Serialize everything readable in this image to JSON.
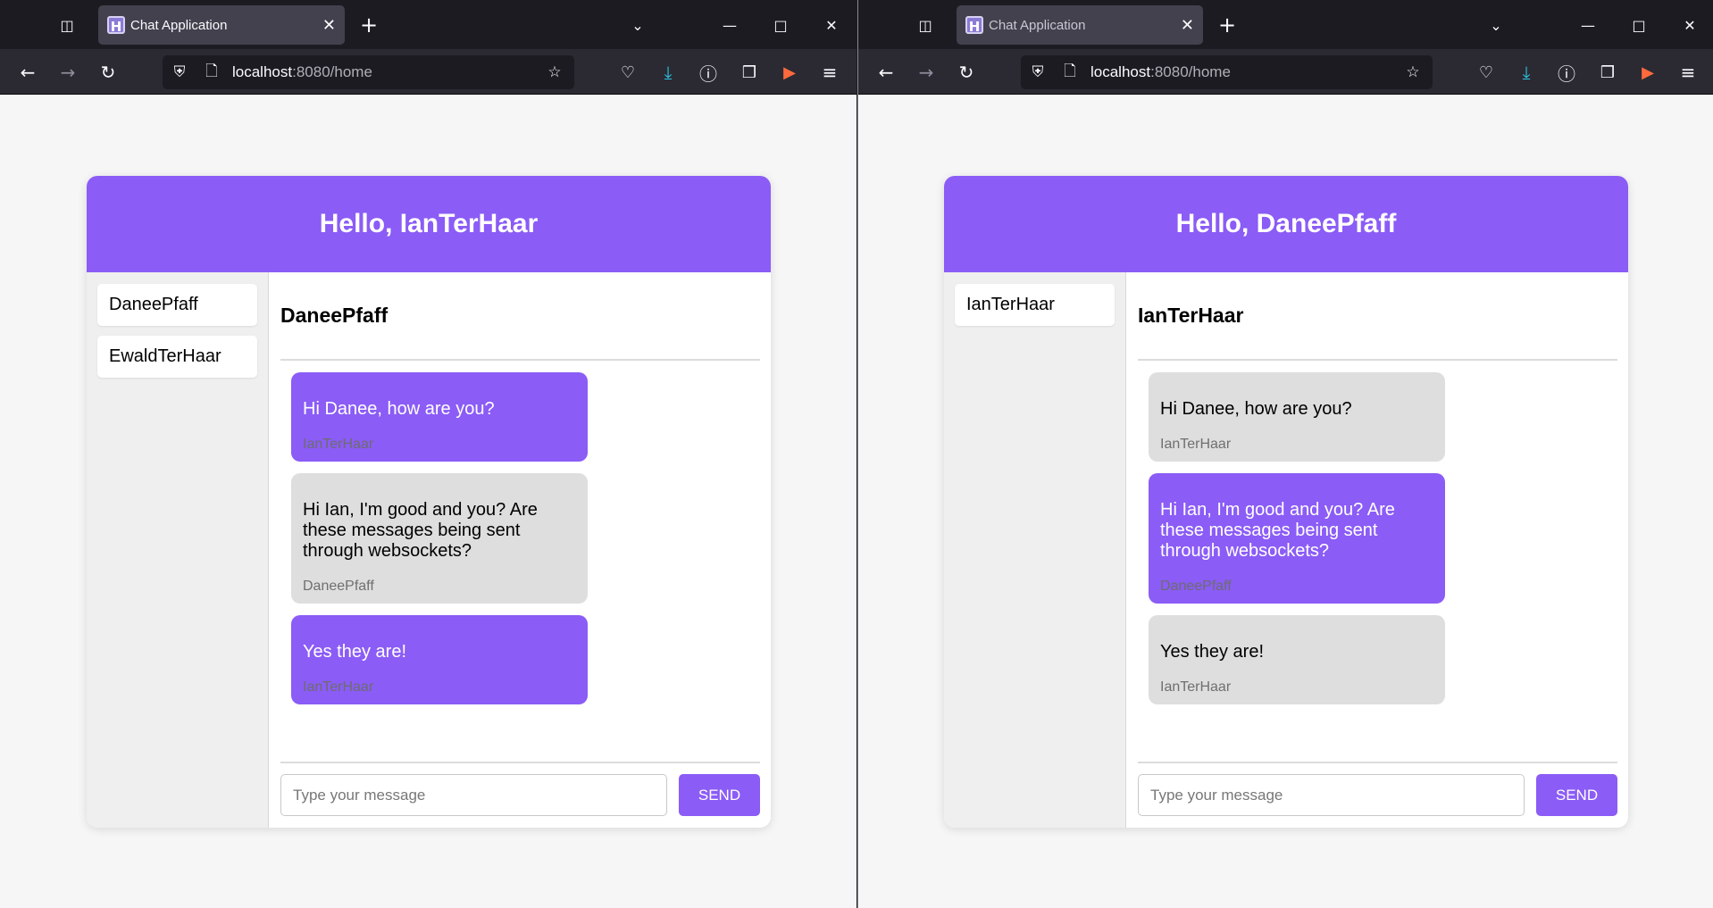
{
  "colors": {
    "accent": "#8b5cf6",
    "received_bubble": "#dedede",
    "browser_chrome": "#1c1b22"
  },
  "browser": {
    "tab_title": "Chat Application",
    "url_host": "localhost",
    "url_path": ":8080/home",
    "icons": [
      "tab-overview-icon",
      "favicon-h-icon",
      "tab-close-icon",
      "new-tab-icon",
      "tab-list-chevron-icon",
      "minimize-icon",
      "maximize-icon",
      "window-close-icon",
      "back-icon",
      "forward-icon",
      "reload-icon",
      "shield-icon",
      "page-icon",
      "bookmark-star-icon",
      "pocket-icon",
      "download-icon",
      "info-icon",
      "extensions-icon",
      "extension-megaphone-icon",
      "menu-icon"
    ]
  },
  "windows": [
    {
      "greeting": "Hello, IanTerHaar",
      "contacts": [
        "DaneePfaff",
        "EwaldTerHaar"
      ],
      "chat_title": "DaneePfaff",
      "messages": [
        {
          "text": "Hi Danee, how are you?",
          "author": "IanTerHaar",
          "type": "sent"
        },
        {
          "text": "Hi Ian, I'm good and you? Are these messages being sent through websockets?",
          "author": "DaneePfaff",
          "type": "recv"
        },
        {
          "text": "Yes they are!",
          "author": "IanTerHaar",
          "type": "sent"
        }
      ],
      "input_placeholder": "Type your message",
      "send_label": "SEND"
    },
    {
      "greeting": "Hello, DaneePfaff",
      "contacts": [
        "IanTerHaar"
      ],
      "chat_title": "IanTerHaar",
      "messages": [
        {
          "text": "Hi Danee, how are you?",
          "author": "IanTerHaar",
          "type": "recv"
        },
        {
          "text": "Hi Ian, I'm good and you? Are these messages being sent through websockets?",
          "author": "DaneePfaff",
          "type": "sent"
        },
        {
          "text": "Yes they are!",
          "author": "IanTerHaar",
          "type": "recv"
        }
      ],
      "input_placeholder": "Type your message",
      "send_label": "SEND"
    }
  ]
}
